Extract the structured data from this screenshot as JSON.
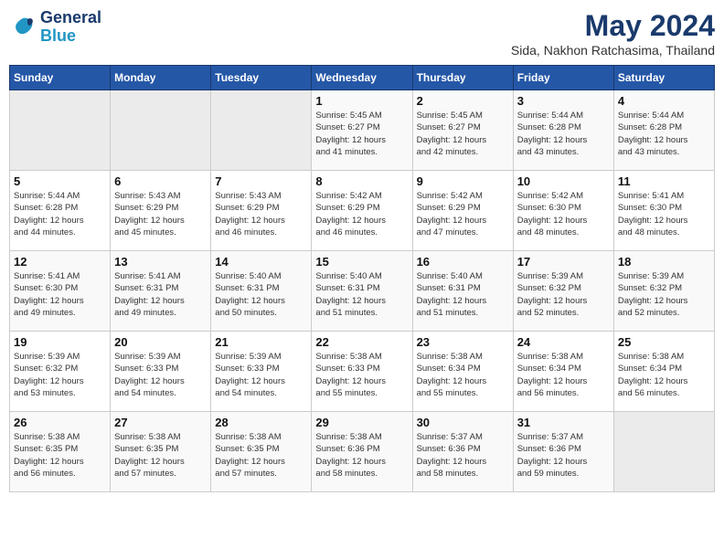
{
  "logo": {
    "line1": "General",
    "line2": "Blue"
  },
  "title": "May 2024",
  "subtitle": "Sida, Nakhon Ratchasima, Thailand",
  "days_of_week": [
    "Sunday",
    "Monday",
    "Tuesday",
    "Wednesday",
    "Thursday",
    "Friday",
    "Saturday"
  ],
  "weeks": [
    [
      {
        "day": "",
        "info": "",
        "empty": true
      },
      {
        "day": "",
        "info": "",
        "empty": true
      },
      {
        "day": "",
        "info": "",
        "empty": true
      },
      {
        "day": "1",
        "info": "Sunrise: 5:45 AM\nSunset: 6:27 PM\nDaylight: 12 hours\nand 41 minutes.",
        "empty": false
      },
      {
        "day": "2",
        "info": "Sunrise: 5:45 AM\nSunset: 6:27 PM\nDaylight: 12 hours\nand 42 minutes.",
        "empty": false
      },
      {
        "day": "3",
        "info": "Sunrise: 5:44 AM\nSunset: 6:28 PM\nDaylight: 12 hours\nand 43 minutes.",
        "empty": false
      },
      {
        "day": "4",
        "info": "Sunrise: 5:44 AM\nSunset: 6:28 PM\nDaylight: 12 hours\nand 43 minutes.",
        "empty": false
      }
    ],
    [
      {
        "day": "5",
        "info": "Sunrise: 5:44 AM\nSunset: 6:28 PM\nDaylight: 12 hours\nand 44 minutes.",
        "empty": false
      },
      {
        "day": "6",
        "info": "Sunrise: 5:43 AM\nSunset: 6:29 PM\nDaylight: 12 hours\nand 45 minutes.",
        "empty": false
      },
      {
        "day": "7",
        "info": "Sunrise: 5:43 AM\nSunset: 6:29 PM\nDaylight: 12 hours\nand 46 minutes.",
        "empty": false
      },
      {
        "day": "8",
        "info": "Sunrise: 5:42 AM\nSunset: 6:29 PM\nDaylight: 12 hours\nand 46 minutes.",
        "empty": false
      },
      {
        "day": "9",
        "info": "Sunrise: 5:42 AM\nSunset: 6:29 PM\nDaylight: 12 hours\nand 47 minutes.",
        "empty": false
      },
      {
        "day": "10",
        "info": "Sunrise: 5:42 AM\nSunset: 6:30 PM\nDaylight: 12 hours\nand 48 minutes.",
        "empty": false
      },
      {
        "day": "11",
        "info": "Sunrise: 5:41 AM\nSunset: 6:30 PM\nDaylight: 12 hours\nand 48 minutes.",
        "empty": false
      }
    ],
    [
      {
        "day": "12",
        "info": "Sunrise: 5:41 AM\nSunset: 6:30 PM\nDaylight: 12 hours\nand 49 minutes.",
        "empty": false
      },
      {
        "day": "13",
        "info": "Sunrise: 5:41 AM\nSunset: 6:31 PM\nDaylight: 12 hours\nand 49 minutes.",
        "empty": false
      },
      {
        "day": "14",
        "info": "Sunrise: 5:40 AM\nSunset: 6:31 PM\nDaylight: 12 hours\nand 50 minutes.",
        "empty": false
      },
      {
        "day": "15",
        "info": "Sunrise: 5:40 AM\nSunset: 6:31 PM\nDaylight: 12 hours\nand 51 minutes.",
        "empty": false
      },
      {
        "day": "16",
        "info": "Sunrise: 5:40 AM\nSunset: 6:31 PM\nDaylight: 12 hours\nand 51 minutes.",
        "empty": false
      },
      {
        "day": "17",
        "info": "Sunrise: 5:39 AM\nSunset: 6:32 PM\nDaylight: 12 hours\nand 52 minutes.",
        "empty": false
      },
      {
        "day": "18",
        "info": "Sunrise: 5:39 AM\nSunset: 6:32 PM\nDaylight: 12 hours\nand 52 minutes.",
        "empty": false
      }
    ],
    [
      {
        "day": "19",
        "info": "Sunrise: 5:39 AM\nSunset: 6:32 PM\nDaylight: 12 hours\nand 53 minutes.",
        "empty": false
      },
      {
        "day": "20",
        "info": "Sunrise: 5:39 AM\nSunset: 6:33 PM\nDaylight: 12 hours\nand 54 minutes.",
        "empty": false
      },
      {
        "day": "21",
        "info": "Sunrise: 5:39 AM\nSunset: 6:33 PM\nDaylight: 12 hours\nand 54 minutes.",
        "empty": false
      },
      {
        "day": "22",
        "info": "Sunrise: 5:38 AM\nSunset: 6:33 PM\nDaylight: 12 hours\nand 55 minutes.",
        "empty": false
      },
      {
        "day": "23",
        "info": "Sunrise: 5:38 AM\nSunset: 6:34 PM\nDaylight: 12 hours\nand 55 minutes.",
        "empty": false
      },
      {
        "day": "24",
        "info": "Sunrise: 5:38 AM\nSunset: 6:34 PM\nDaylight: 12 hours\nand 56 minutes.",
        "empty": false
      },
      {
        "day": "25",
        "info": "Sunrise: 5:38 AM\nSunset: 6:34 PM\nDaylight: 12 hours\nand 56 minutes.",
        "empty": false
      }
    ],
    [
      {
        "day": "26",
        "info": "Sunrise: 5:38 AM\nSunset: 6:35 PM\nDaylight: 12 hours\nand 56 minutes.",
        "empty": false
      },
      {
        "day": "27",
        "info": "Sunrise: 5:38 AM\nSunset: 6:35 PM\nDaylight: 12 hours\nand 57 minutes.",
        "empty": false
      },
      {
        "day": "28",
        "info": "Sunrise: 5:38 AM\nSunset: 6:35 PM\nDaylight: 12 hours\nand 57 minutes.",
        "empty": false
      },
      {
        "day": "29",
        "info": "Sunrise: 5:38 AM\nSunset: 6:36 PM\nDaylight: 12 hours\nand 58 minutes.",
        "empty": false
      },
      {
        "day": "30",
        "info": "Sunrise: 5:37 AM\nSunset: 6:36 PM\nDaylight: 12 hours\nand 58 minutes.",
        "empty": false
      },
      {
        "day": "31",
        "info": "Sunrise: 5:37 AM\nSunset: 6:36 PM\nDaylight: 12 hours\nand 59 minutes.",
        "empty": false
      },
      {
        "day": "",
        "info": "",
        "empty": true
      }
    ]
  ]
}
